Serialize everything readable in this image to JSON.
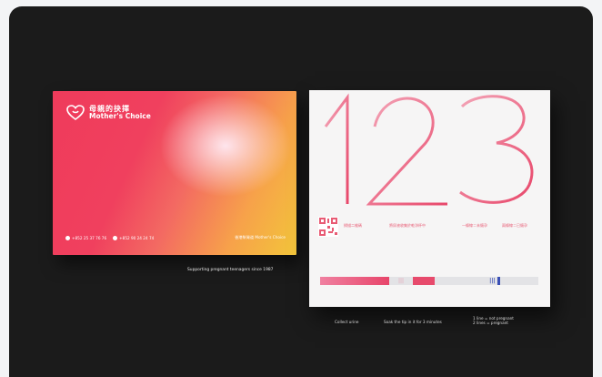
{
  "brand": {
    "name_cn": "母親的抉擇",
    "name_en": "Mother's Choice"
  },
  "card": {
    "phone": "+852 25 37 76 76",
    "whatsapp": "+852 90 24 24 74",
    "address": "香港柴灣道 Mother's Choice"
  },
  "tagline": "Supporting pregnant teenagers since 1987",
  "leaflet": {
    "big_number": "123",
    "qr_caption": "掃描二維碼",
    "step1": "將尿液收集於乾淨杯中",
    "step2": "一條線＝未懷孕",
    "step3": "兩條線＝已懷孕",
    "result_marks": [
      "|||",
      "|||"
    ]
  },
  "labels": {
    "collect": "Collect urine",
    "soak": "Soak the tip in it for 3 minutes",
    "legend_line1": "1 line = not pregnant",
    "legend_line2": "2 lines = pregnant"
  },
  "colors": {
    "background": "#1b1b1b",
    "brand_pink": "#e85b74",
    "result_blue": "#3a4fb5"
  }
}
